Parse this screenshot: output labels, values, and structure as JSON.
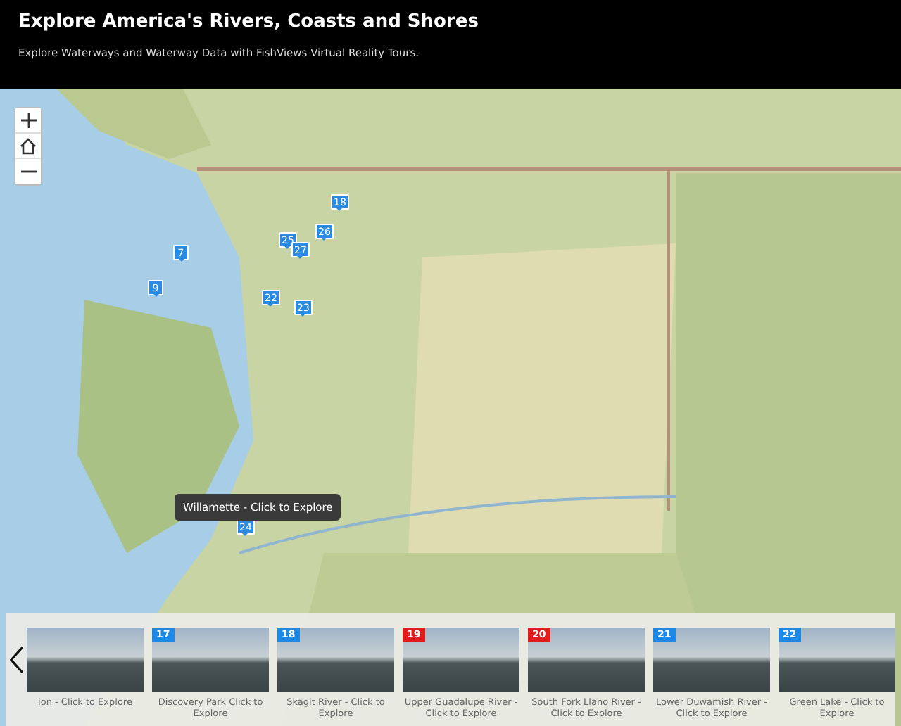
{
  "header": {
    "title": "Explore America's Rivers, Coasts and Shores",
    "subtitle": "Explore Waterways and Waterway Data with FishViews Virtual Reality Tours."
  },
  "map_controls": [
    {
      "kind": "zoom-in"
    },
    {
      "kind": "home"
    },
    {
      "kind": "zoom-out"
    }
  ],
  "map_pins": [
    {
      "label": "18"
    },
    {
      "label": "25"
    },
    {
      "label": "26"
    },
    {
      "label": "27"
    },
    {
      "label": "7"
    },
    {
      "label": "9"
    },
    {
      "label": "22"
    },
    {
      "label": "23"
    },
    {
      "label": "24"
    }
  ],
  "tooltip": {
    "text": "Willamette - Click to Explore"
  },
  "carousel": {
    "items": [
      {
        "caption": "ion - Click to Explore"
      },
      {
        "badge": "17",
        "color": "#1e88e5",
        "caption": "Discovery Park Click to Explore"
      },
      {
        "badge": "18",
        "color": "#1e88e5",
        "caption": "Skagit River - Click to Explore"
      },
      {
        "badge": "19",
        "color": "#e01b1b",
        "caption": "Upper Guadalupe River - Click to Explore"
      },
      {
        "badge": "20",
        "color": "#e01b1b",
        "caption": "South Fork Llano River - Click to Explore"
      },
      {
        "badge": "21",
        "color": "#1e88e5",
        "caption": "Lower Duwamish River - Click to Explore"
      },
      {
        "badge": "22",
        "color": "#1e88e5",
        "caption": "Green Lake - Click to Explore"
      }
    ]
  }
}
